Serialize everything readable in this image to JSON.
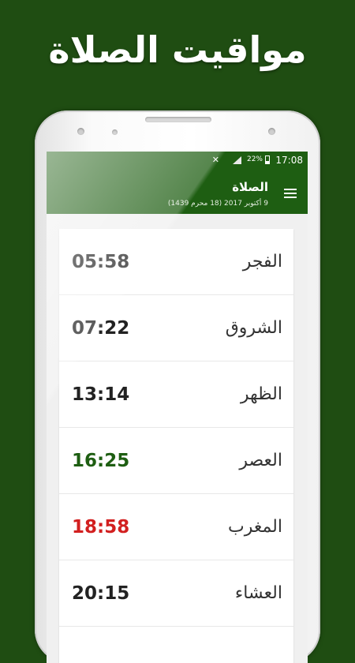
{
  "promo": {
    "title": "مواقيت الصلاة"
  },
  "status_bar": {
    "time": "17:08",
    "battery": "22%",
    "icons": [
      "mute-icon",
      "signal-icon",
      "battery-icon"
    ]
  },
  "app_bar": {
    "title": "الصلاة",
    "subtitle": "9 أكتوبر 2017 (18 محرم 1439)",
    "menu_icon": "menu-icon"
  },
  "prayers": [
    {
      "name": "الفجر",
      "time": "05:58",
      "color": "#222222"
    },
    {
      "name": "الشروق",
      "time": "07:22",
      "color": "#222222"
    },
    {
      "name": "الظهر",
      "time": "13:14",
      "color": "#222222"
    },
    {
      "name": "العصر",
      "time": "16:25",
      "color": "#1e5e12"
    },
    {
      "name": "المغرب",
      "time": "18:58",
      "color": "#d21f1f"
    },
    {
      "name": "العشاء",
      "time": "20:15",
      "color": "#222222"
    }
  ],
  "colors": {
    "background": "#1f4d12",
    "app_bar": "#1e5e12",
    "next_prayer": "#1e5e12",
    "current_prayer": "#d21f1f"
  }
}
